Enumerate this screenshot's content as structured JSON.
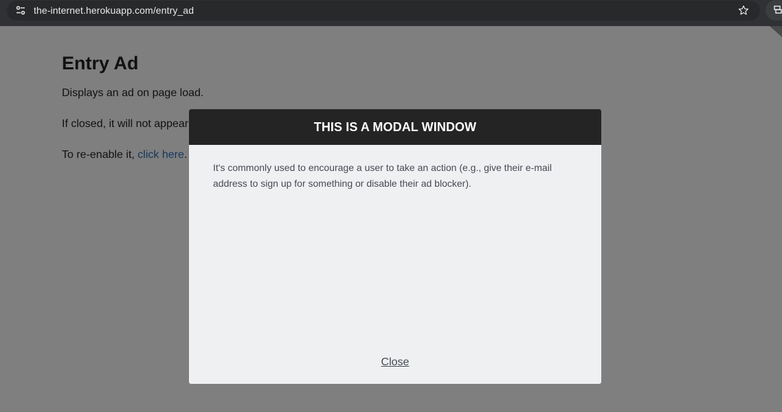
{
  "browser": {
    "url": "the-internet.herokuapp.com/entry_ad",
    "icons": {
      "site_info": "tune-icon",
      "bookmark": "star-icon",
      "extension": "extension-icon"
    }
  },
  "page": {
    "title": "Entry Ad",
    "paragraphs": {
      "p1": "Displays an ad on page load.",
      "p2": "If closed, it will not appear on subsequent page loads.",
      "p3_prefix": "To re-enable it, ",
      "p3_link": "click here",
      "p3_suffix": "."
    }
  },
  "modal": {
    "title": "THIS IS A MODAL WINDOW",
    "body": "It's commonly used to encourage a user to take an action (e.g., give their e-mail address to sign up for something or disable their ad blocker).",
    "close_label": "Close"
  },
  "colors": {
    "modal_header": "#242424",
    "modal_body": "#eff0f2",
    "overlay": "rgba(0,0,0,0.5)",
    "link": "#2a6ebb"
  }
}
